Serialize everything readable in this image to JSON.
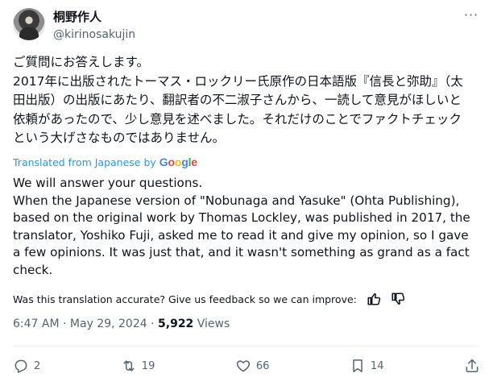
{
  "header": {
    "display_name": "桐野作人",
    "handle": "@kirinosakujin",
    "more_label": "···"
  },
  "body_ja": {
    "line1": "ご質問にお答えします。",
    "line2": "2017年に出版されたトーマス・ロックリー氏原作の日本語版『信長と弥助』（太田出版）の出版にあたり、翻訳者の不二淑子さんから、一読して意見がほしいと依頼があったので、少し意見を述べました。それだけのことでファクトチェックという大げさなものではありません。"
  },
  "translation": {
    "label": "Translated from Japanese by",
    "google": [
      "G",
      "o",
      "o",
      "g",
      "l",
      "e"
    ],
    "google_colors": [
      "#4285f4",
      "#ea4335",
      "#fbbc05",
      "#4285f4",
      "#34a853",
      "#ea4335"
    ]
  },
  "body_en": "We will answer your questions.\nWhen the Japanese version of \"Nobunaga and Yasuke\" (Ohta Publishing), based on the original work by Thomas Lockley, was published in 2017, the translator, Yoshiko Fuji, asked me to read it and give my opinion, so I gave a few opinions. It was just that, and it wasn't something as grand as a fact check.",
  "feedback": {
    "text": "Was this translation accurate? Give us feedback so we can improve:"
  },
  "meta": {
    "time": "6:47 AM",
    "sep": " · ",
    "date": "May 29, 2024",
    "views_count": "5,922",
    "views_label": " Views"
  },
  "actions": {
    "replies": "2",
    "reposts": "19",
    "likes": "66",
    "bookmarks": "14"
  },
  "icons": {
    "reply": "reply-icon",
    "repost": "repost-icon",
    "like": "heart-icon",
    "bookmark": "bookmark-icon",
    "share": "share-icon",
    "thumbs_up": "thumbs-up-icon",
    "thumbs_down": "thumbs-down-icon"
  },
  "colors": {
    "text": "#0f1419",
    "secondary": "#536471",
    "link": "#1d9bf0",
    "divider": "#eff3f4"
  }
}
